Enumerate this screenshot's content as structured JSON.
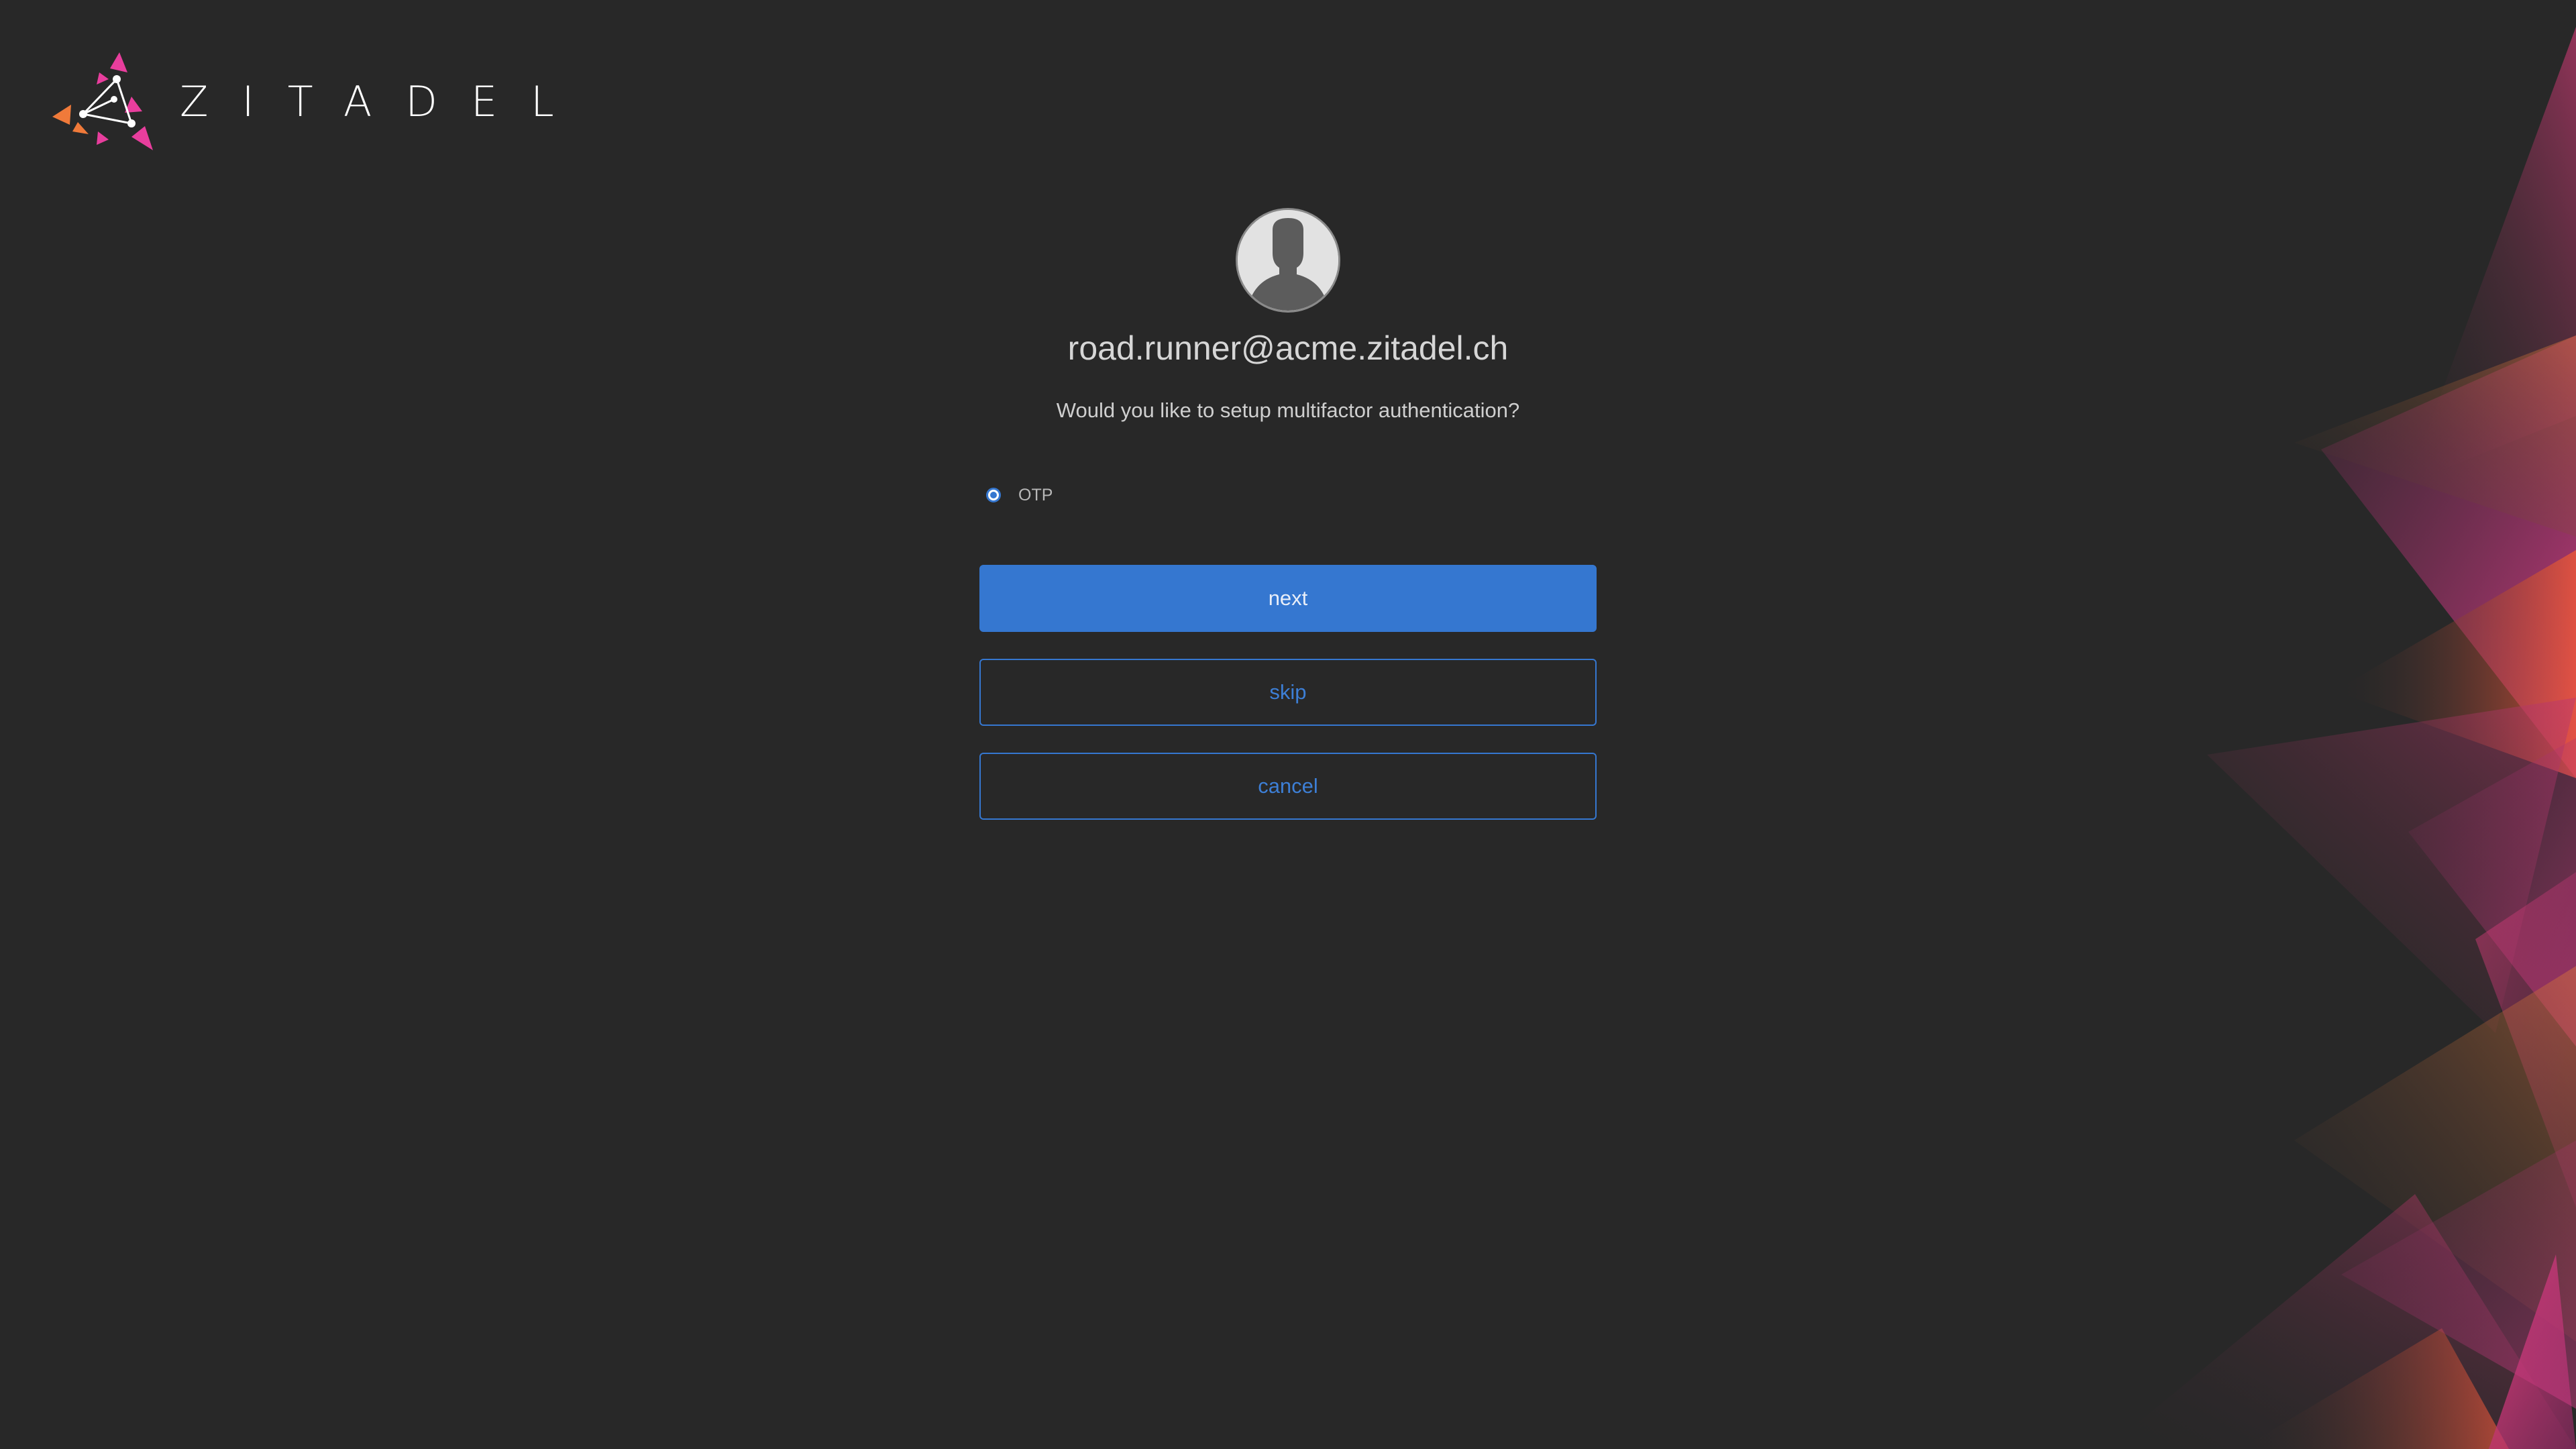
{
  "brand": {
    "name": "ZITADEL",
    "colors": {
      "pink": "#e83e9d",
      "orange": "#f07a3a",
      "accent": "#3577d0",
      "background": "#282828"
    }
  },
  "user": {
    "login_name": "road.runner@acme.zitadel.ch",
    "avatar_icon": "user-silhouette-icon"
  },
  "prompt": {
    "question": "Would you like to setup multifactor authentication?"
  },
  "mfa_options": [
    {
      "label": "OTP",
      "selected": true
    }
  ],
  "buttons": {
    "next": "next",
    "skip": "skip",
    "cancel": "cancel"
  }
}
